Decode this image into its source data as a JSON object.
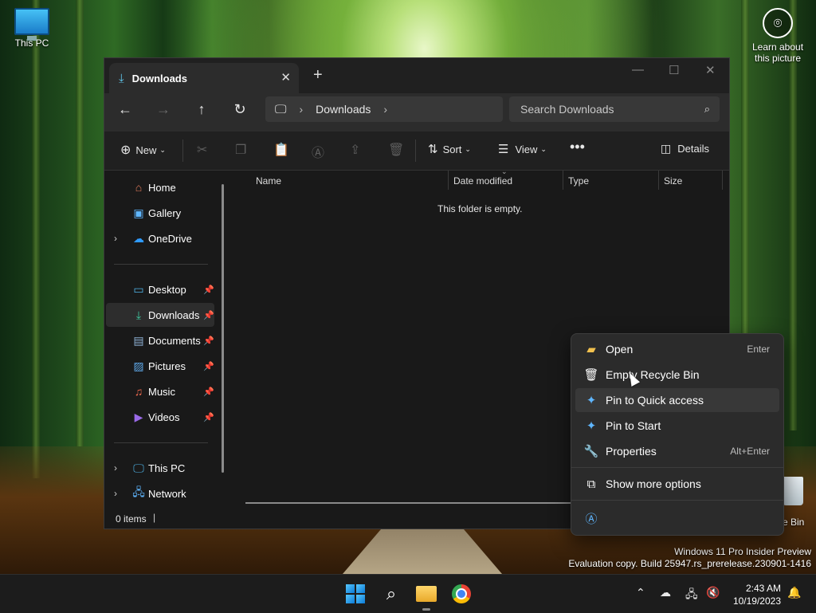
{
  "desktop": {
    "this_pc_label": "This PC",
    "learn_label": "Learn about this picture",
    "recycle_label": "e Bin",
    "watermark_line1": "Windows 11 Pro Insider Preview",
    "watermark_line2": "Evaluation copy. Build 25947.rs_prerelease.230901-1416"
  },
  "window": {
    "tab_title": "Downloads",
    "address_crumb": "Downloads",
    "search_placeholder": "Search Downloads"
  },
  "toolbar": {
    "new_label": "New",
    "sort_label": "Sort",
    "view_label": "View",
    "details_label": "Details"
  },
  "sidebar": {
    "items": [
      {
        "label": "Home",
        "icon": "home-icon"
      },
      {
        "label": "Gallery",
        "icon": "gallery-icon"
      },
      {
        "label": "OneDrive",
        "icon": "cloud-icon"
      },
      {
        "label": "Desktop",
        "icon": "desktop-icon"
      },
      {
        "label": "Downloads",
        "icon": "download-icon"
      },
      {
        "label": "Documents",
        "icon": "document-icon"
      },
      {
        "label": "Pictures",
        "icon": "pictures-icon"
      },
      {
        "label": "Music",
        "icon": "music-icon"
      },
      {
        "label": "Videos",
        "icon": "video-icon"
      },
      {
        "label": "This PC",
        "icon": "computer-icon"
      },
      {
        "label": "Network",
        "icon": "network-icon"
      }
    ]
  },
  "content": {
    "columns": [
      "Name",
      "Date modified",
      "Type",
      "Size"
    ],
    "empty_message": "This folder is empty."
  },
  "status": {
    "item_count": "0 items"
  },
  "context_menu": {
    "items": [
      {
        "label": "Open",
        "shortcut": "Enter"
      },
      {
        "label": "Empty Recycle Bin",
        "shortcut": ""
      },
      {
        "label": "Pin to Quick access",
        "shortcut": ""
      },
      {
        "label": "Pin to Start",
        "shortcut": ""
      },
      {
        "label": "Properties",
        "shortcut": "Alt+Enter"
      },
      {
        "label": "Show more options",
        "shortcut": ""
      }
    ]
  },
  "taskbar": {
    "time": "2:43 AM",
    "date": "10/19/2023"
  },
  "colors": {
    "accent": "#5fc3e8",
    "window_bg": "#191919",
    "menu_bg": "#2b2b2b"
  }
}
